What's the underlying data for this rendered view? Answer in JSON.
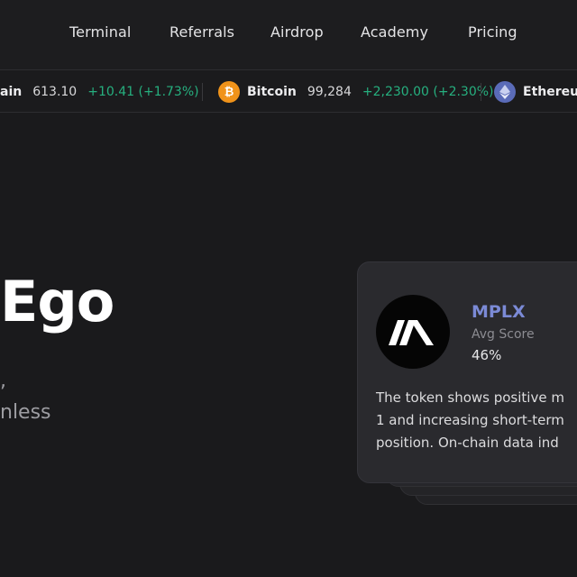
{
  "nav": {
    "items": [
      {
        "label": "Terminal"
      },
      {
        "label": "Referrals"
      },
      {
        "label": "Airdrop"
      },
      {
        "label": "Academy"
      },
      {
        "label": "Pricing"
      }
    ]
  },
  "ticker": {
    "items": [
      {
        "name": "ain",
        "price": "613.10",
        "change": "+10.41 (+1.73%)",
        "icon": ""
      },
      {
        "name": "Bitcoin",
        "price": "99,284",
        "change": "+2,230.00 (+2.30%)",
        "icon": "bitcoin-icon"
      },
      {
        "name": "Ethereu",
        "price": "",
        "change": "",
        "icon": "ethereum-icon"
      }
    ],
    "colors": {
      "positive": "#26b07f"
    }
  },
  "hero": {
    "title": "Ego",
    "subtitle_line1": ",",
    "subtitle_line2": "nless"
  },
  "card": {
    "symbol": "MPLX",
    "score_label": "Avg Score",
    "score_value": "46%",
    "description_lines": [
      "The token shows positive m",
      "1 and increasing short-term",
      "position. On-chain data ind"
    ],
    "logo_icon": "mplx-logo-icon",
    "colors": {
      "symbol": "#7b8ad6"
    }
  }
}
